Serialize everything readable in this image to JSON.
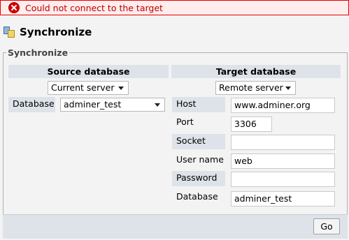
{
  "error": {
    "message": "Could not connect to the target",
    "icon": "error-icon"
  },
  "header": {
    "title": "Synchronize",
    "icon": "synchronize-icon"
  },
  "fieldset": {
    "legend": "Synchronize"
  },
  "source": {
    "heading": "Source database",
    "server_select": "Current server",
    "database_label": "Database",
    "database_select": "adminer_test"
  },
  "target": {
    "heading": "Target database",
    "server_select": "Remote server",
    "fields": {
      "host_label": "Host",
      "host_value": "www.adminer.org",
      "port_label": "Port",
      "port_value": "3306",
      "socket_label": "Socket",
      "socket_value": "",
      "username_label": "User name",
      "username_value": "web",
      "password_label": "Password",
      "password_value": "",
      "database_label": "Database",
      "database_value": "adminer_test"
    }
  },
  "footer": {
    "go_label": "Go"
  },
  "colors": {
    "error_border": "#e40000",
    "header_bg": "#dde3e9"
  }
}
